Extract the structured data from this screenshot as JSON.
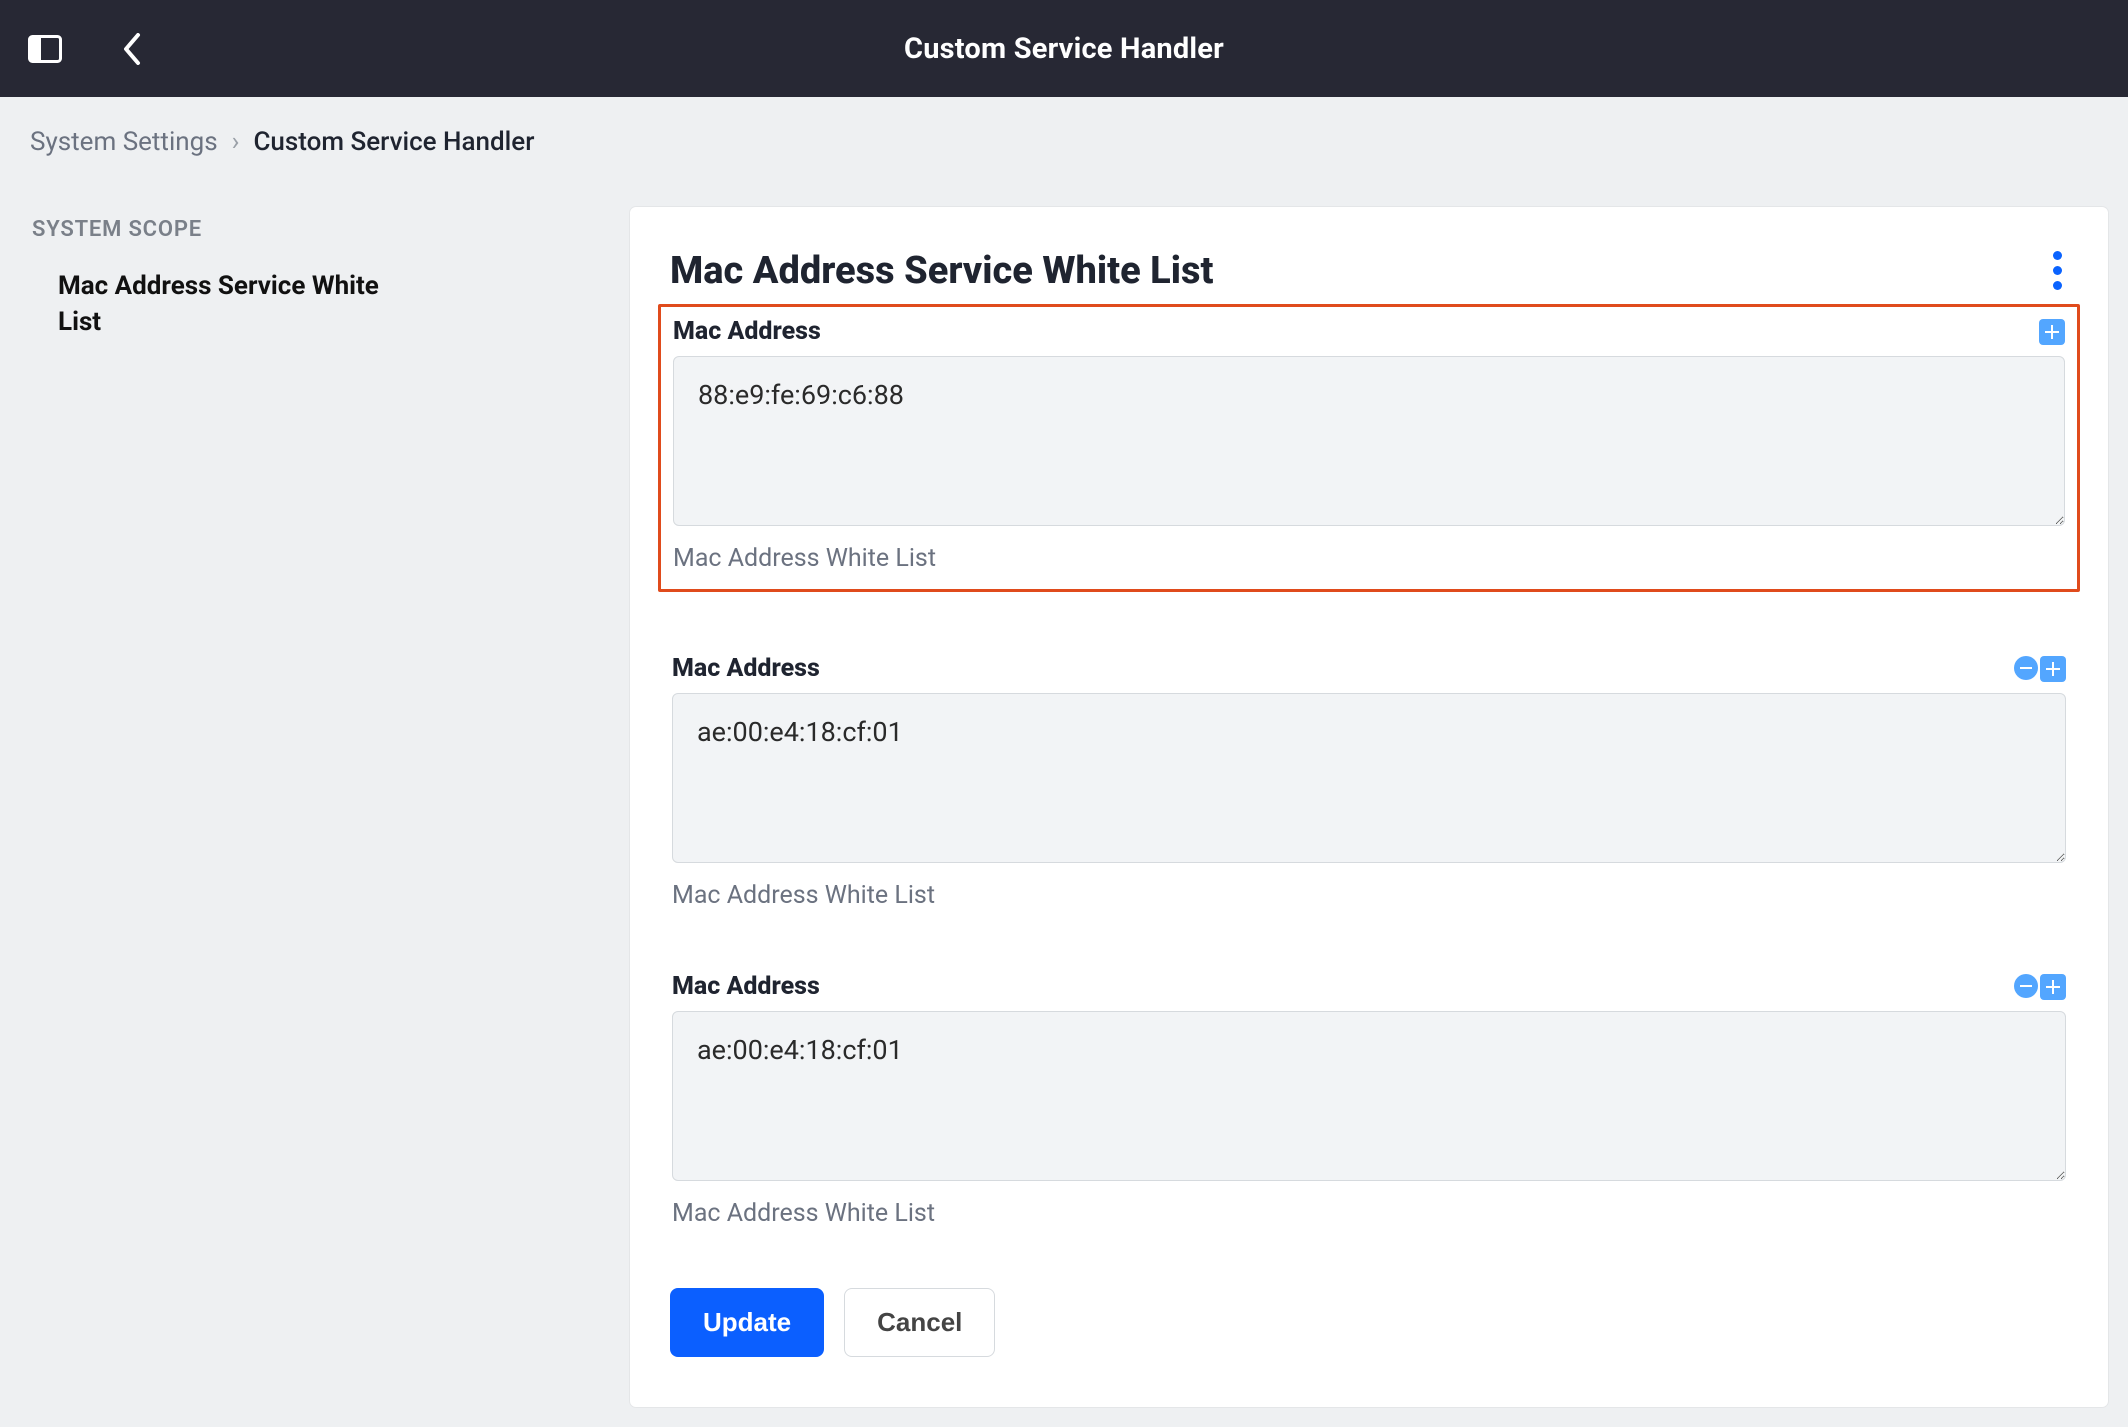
{
  "header": {
    "title": "Custom Service Handler"
  },
  "breadcrumbs": {
    "parent": "System Settings",
    "current": "Custom Service Handler"
  },
  "sidebar": {
    "heading": "SYSTEM SCOPE",
    "items": [
      {
        "label": "Mac Address Service White List"
      }
    ]
  },
  "card": {
    "title": "Mac Address Service White List",
    "fields": [
      {
        "label": "Mac Address",
        "value": "88:e9:fe:69:c6:88",
        "helper": "Mac Address White List",
        "highlight": true,
        "controls": [
          "add"
        ]
      },
      {
        "label": "Mac Address",
        "value": "ae:00:e4:18:cf:01",
        "helper": "Mac Address White List",
        "highlight": false,
        "controls": [
          "remove",
          "add"
        ]
      },
      {
        "label": "Mac Address",
        "value": "ae:00:e4:18:cf:01",
        "helper": "Mac Address White List",
        "highlight": false,
        "controls": [
          "remove",
          "add"
        ]
      }
    ],
    "actions": {
      "primary": "Update",
      "secondary": "Cancel"
    }
  }
}
